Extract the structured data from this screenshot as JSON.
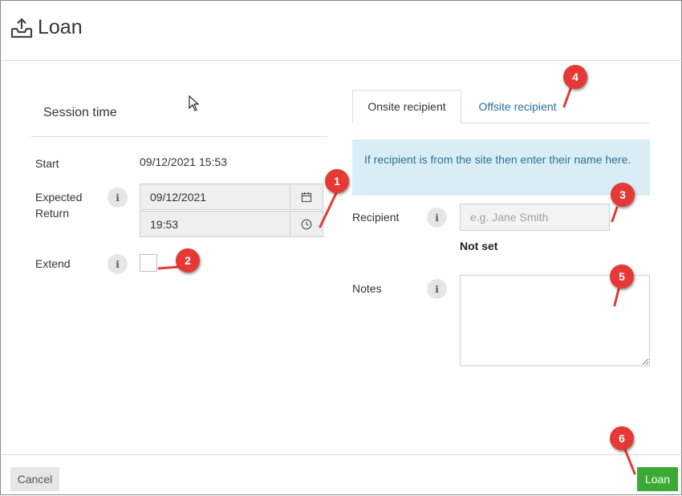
{
  "header": {
    "title": "Loan",
    "icon": "upload-tray-icon"
  },
  "session": {
    "title": "Session time",
    "start_label": "Start",
    "start_value": "09/12/2021 15:53",
    "expected_return_label": "Expected Return",
    "expected_return_date": "09/12/2021",
    "expected_return_time": "19:53",
    "extend_label": "Extend",
    "info_glyph": "ℹ"
  },
  "tabs": [
    {
      "label": "Onsite recipient",
      "active": true
    },
    {
      "label": "Offsite recipient",
      "active": false
    }
  ],
  "alert": {
    "text": "If recipient is from the site then enter their name here."
  },
  "recipient": {
    "label": "Recipient",
    "placeholder": "e.g. Jane Smith",
    "status": "Not set"
  },
  "notes": {
    "label": "Notes",
    "value": ""
  },
  "footer": {
    "cancel_label": "Cancel",
    "loan_label": "Loan"
  },
  "callouts": [
    "1",
    "2",
    "3",
    "4",
    "5",
    "6"
  ],
  "colors": {
    "primary_button": "#3aaa35",
    "alert_bg": "#d9edf7",
    "alert_text": "#31708f",
    "tab_link": "#2a6ea0",
    "callout": "#e53935"
  }
}
